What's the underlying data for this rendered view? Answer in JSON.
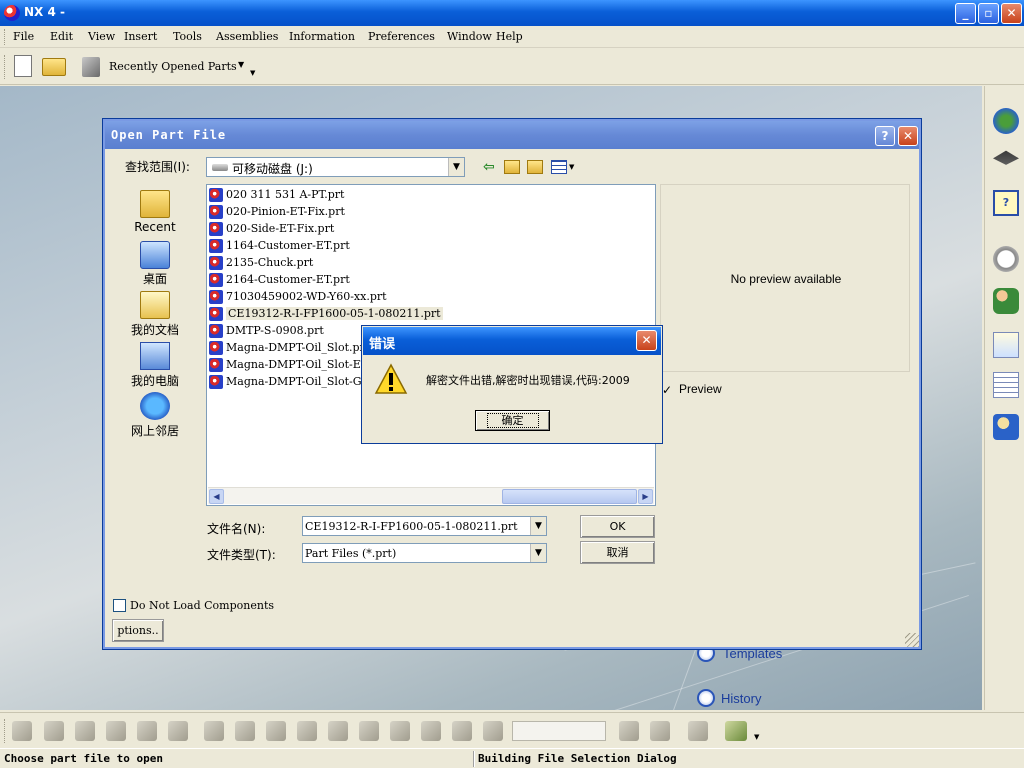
{
  "window": {
    "title": "NX 4 -",
    "minimize": "_",
    "restore": "▫",
    "close": "✕"
  },
  "menu": [
    "File",
    "Edit",
    "View",
    "Insert",
    "Tools",
    "Assemblies",
    "Information",
    "Preferences",
    "Window",
    "Help"
  ],
  "toolbar": {
    "recent_label": "Recently Opened Parts"
  },
  "resources": {
    "templates": "Templates",
    "history": "History"
  },
  "dialog": {
    "title": "Open Part File",
    "help": "?",
    "close": "✕",
    "look_in_label": "查找范围(I):",
    "look_in_value": "可移动磁盘  (J:)",
    "places": [
      "Recent",
      "桌面",
      "我的文档",
      "我的电脑",
      "网上邻居"
    ],
    "files": [
      "020 311 531 A-PT.prt",
      "020-Pinion-ET-Fix.prt",
      "020-Side-ET-Fix.prt",
      "1164-Customer-ET.prt",
      "2135-Chuck.prt",
      "2164-Customer-ET.prt",
      "71030459002-WD-Y60-xx.prt",
      "CE19312-R-I-FP1600-05-1-080211.prt",
      "DMTP-S-0908.prt",
      "Magna-DMPT-Oil_Slot.prt",
      "Magna-DMPT-Oil_Slot-ET.",
      "Magna-DMPT-Oil_Slot-Gus"
    ],
    "selected_index": 7,
    "preview_text": "No preview available",
    "preview_check": "Preview",
    "filename_label": "文件名(N):",
    "filename_value": "CE19312-R-I-FP1600-05-1-080211.prt",
    "filetype_label": "文件类型(T):",
    "filetype_value": "Part Files (*.prt)",
    "ok_button": "OK",
    "cancel_button": "取消",
    "no_load_components": "Do Not Load Components",
    "options_button": "ptions.."
  },
  "error": {
    "title": "错误",
    "close": "✕",
    "message": "解密文件出错,解密时出现错误,代码:2009",
    "ok": "确定"
  },
  "status": {
    "left": "Choose part file to open",
    "right": "Building File Selection Dialog"
  },
  "colors": {
    "xp_title": "#0a5fd8",
    "dialog_title": "#6689d6",
    "face": "#ece9d8"
  }
}
